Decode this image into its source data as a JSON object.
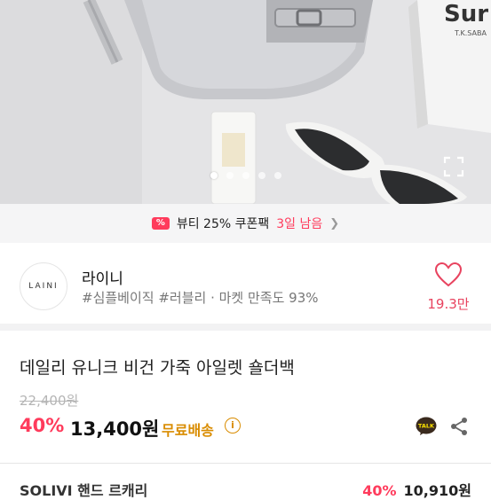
{
  "hero": {
    "box_text": "T.K.SABA",
    "box_logo": "Sur",
    "dots_count": 5,
    "active_dot": 1
  },
  "coupon": {
    "icon": "coupon-ticket-icon",
    "text": "뷰티 25% 쿠폰팩",
    "days": "3일 남음",
    "chevron": "❯"
  },
  "shop": {
    "logo_text": "LAINI",
    "name": "라이니",
    "tags": "#심플베이직 #러블리 · 마켓 만족도 93%",
    "like_count": "19.3만"
  },
  "product": {
    "title": "데일리 유니크 비건 가죽 아일렛 숄더백",
    "original_price": "22,400원",
    "discount": "40%",
    "price": "13,400원",
    "shipping": "무료배송",
    "info": "i",
    "talk_label": "TALK"
  },
  "bottom": {
    "left": "SOLIVI 핸드 르캐리",
    "discount": "40%",
    "price": "10,910원"
  },
  "colors": {
    "accent": "#ff3b5c",
    "shipping": "#d98c00",
    "like": "#e8435f"
  }
}
